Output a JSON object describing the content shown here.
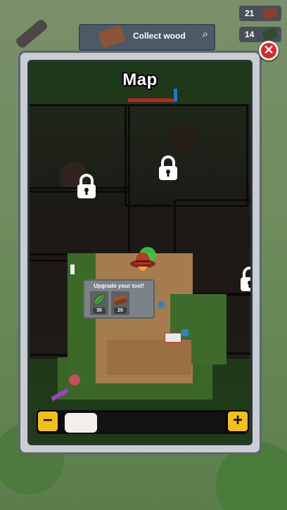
{
  "hud": {
    "quest_label": "Collect wood",
    "counters": [
      {
        "value": "21"
      },
      {
        "value": "14"
      }
    ]
  },
  "modal": {
    "title": "Map",
    "close_icon": "close-x"
  },
  "map": {
    "locked_areas": 3,
    "player_icon": "cowboy-hat-player"
  },
  "tooltip": {
    "title": "Upgrade your tool!",
    "resources": [
      {
        "icon": "leaf",
        "qty": "30"
      },
      {
        "icon": "wood-plank",
        "qty": "20"
      }
    ]
  },
  "zoom": {
    "minus_label": "−",
    "plus_label": "+",
    "level": 0.2
  },
  "colors": {
    "accent": "#f3c017",
    "close": "#e02626"
  }
}
